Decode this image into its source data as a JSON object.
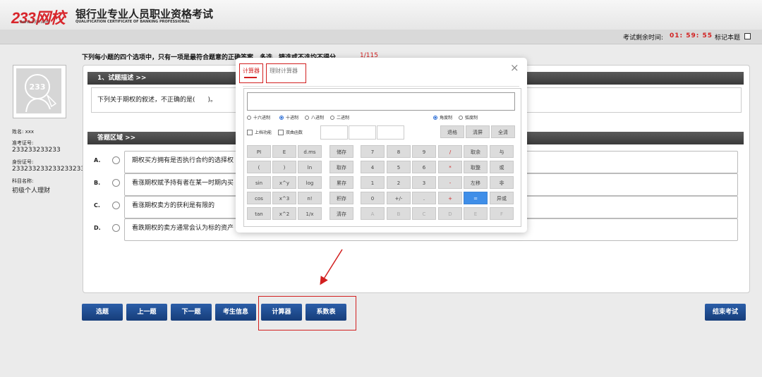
{
  "header": {
    "logo": "233网校",
    "logo_sub": "www.233.com",
    "title": "银行业专业人员职业资格考试",
    "title_en": "QUALIFICATION CERTIFICATE OF BANKING PROFESSIONAL"
  },
  "status_bar": {
    "timer_label": "考试剩余时间:",
    "timer": "01: 59: 55",
    "mark_label": "标记本题"
  },
  "instruction": "下列每小题的四个选项中，只有一项是最符合题意的正确答案，多选、错选或不选均不得分",
  "question_number": "1/115",
  "candidate": {
    "name_label": "姓名: xxx",
    "exam_id_label": "准考证号:",
    "exam_id": "233233233233",
    "id_label": "身份证号:",
    "id_number": "233233233233233233",
    "subject_label": "科目名称:",
    "subject": "初级个人理财"
  },
  "question": {
    "section_title": "1、试题描述 >>",
    "text": "下列关于期权的叙述，不正确的是(　　)。"
  },
  "answer": {
    "section_title": "答题区域 >>",
    "options": [
      {
        "letter": "A.",
        "text": "期权买方拥有是否执行合约的选择权"
      },
      {
        "letter": "B.",
        "text": "看涨期权赋予持有者在某一时期内买"
      },
      {
        "letter": "C.",
        "text": "看涨期权卖方的获利是有限的"
      },
      {
        "letter": "D.",
        "text": "看跌期权的卖方通常会认为标的资产"
      }
    ]
  },
  "buttons": {
    "select": "选题",
    "prev": "上一题",
    "next": "下一题",
    "info": "考生信息",
    "calculator": "计算器",
    "coef": "系数表",
    "finish": "结束考试"
  },
  "calculator": {
    "tab_basic": "计算器",
    "tab_finance": "理财计算器",
    "close": "×",
    "radix": [
      "十六进制",
      "十进制",
      "八进制",
      "二进制"
    ],
    "angle": [
      "角度制",
      "弧度制"
    ],
    "check_shift": "上档功能",
    "check_hyp": "双曲函数",
    "top_buttons": [
      "退格",
      "清屏",
      "全清"
    ],
    "sci_col1": [
      "PI",
      "(",
      "sin",
      "cos",
      "tan"
    ],
    "sci_col2": [
      "E",
      ")",
      "x^y",
      "x^3",
      "x^2"
    ],
    "sci_col3": [
      "d.ms",
      "ln",
      "log",
      "n!",
      "1/x"
    ],
    "mem_col": [
      "储存",
      "取存",
      "累存",
      "积存",
      "清存"
    ],
    "num_rows": [
      [
        "7",
        "8",
        "9",
        "/",
        "取余",
        "与"
      ],
      [
        "4",
        "5",
        "6",
        "*",
        "取整",
        "或"
      ],
      [
        "1",
        "2",
        "3",
        "-",
        "左移",
        "非"
      ],
      [
        "0",
        "+/-",
        ".",
        "+",
        "=",
        "异或"
      ],
      [
        "A",
        "B",
        "C",
        "D",
        "E",
        "F"
      ]
    ]
  },
  "colors": {
    "accent_red": "#d21f1f",
    "button_blue": "#1e4b8f",
    "equals_blue": "#3f8ee8"
  }
}
